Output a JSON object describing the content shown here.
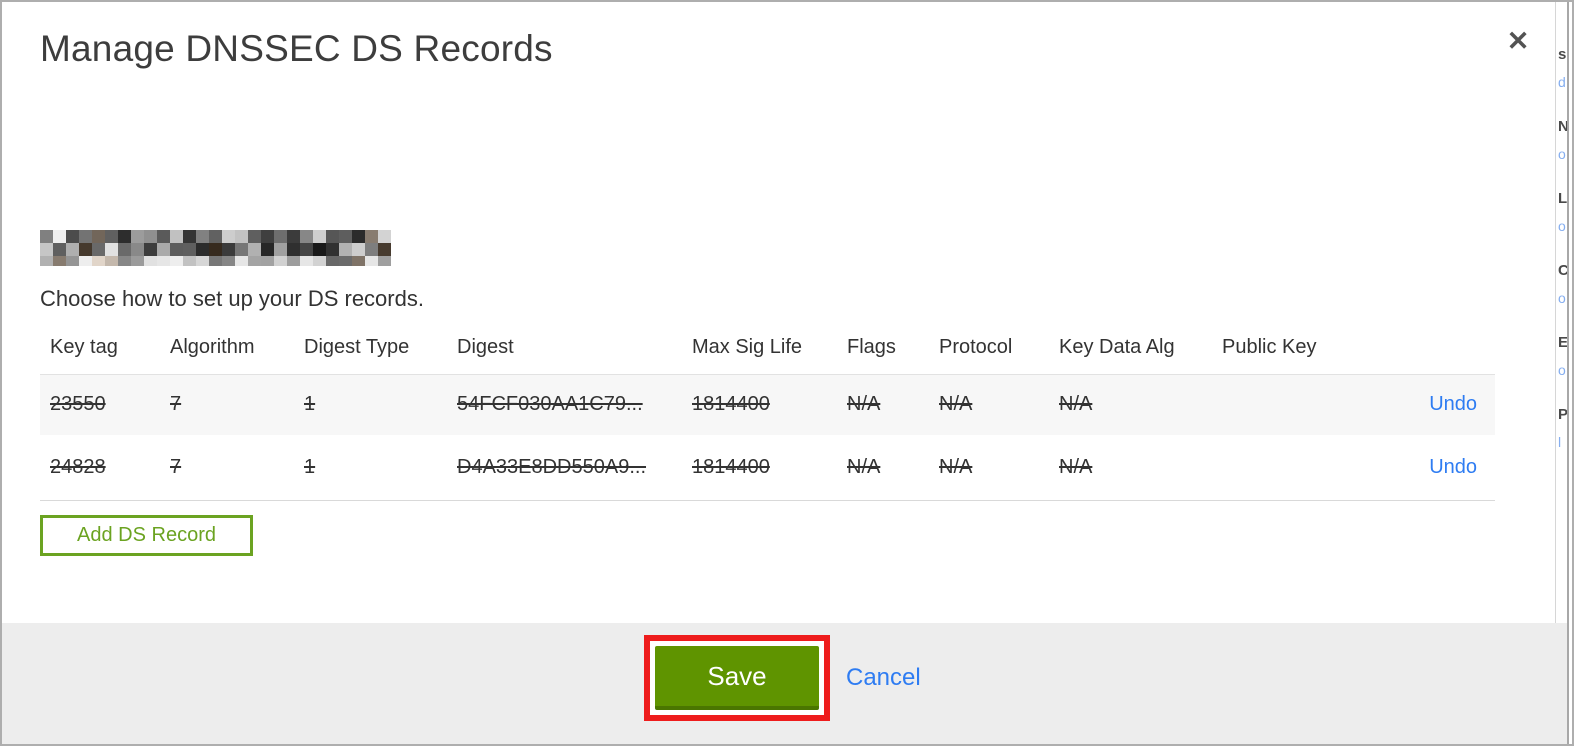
{
  "modal": {
    "title": "Manage DNSSEC DS Records",
    "close_icon": "✕",
    "subtitle": "Choose how to set up your DS records."
  },
  "table": {
    "columns": [
      "Key tag",
      "Algorithm",
      "Digest Type",
      "Digest",
      "Max Sig Life",
      "Flags",
      "Protocol",
      "Key Data Alg",
      "Public Key"
    ],
    "row_keys": [
      "key_tag",
      "algorithm",
      "digest_type",
      "digest",
      "max_sig_life",
      "flags",
      "protocol",
      "key_data_alg",
      "public_key"
    ],
    "rows": [
      {
        "key_tag": "23550",
        "algorithm": "7",
        "digest_type": "1",
        "digest": "54FCF030AA1C79...",
        "max_sig_life": "1814400",
        "flags": "N/A",
        "protocol": "N/A",
        "key_data_alg": "N/A",
        "public_key": "",
        "action": "Undo",
        "struck": true
      },
      {
        "key_tag": "24828",
        "algorithm": "7",
        "digest_type": "1",
        "digest": "D4A33E8DD550A9...",
        "max_sig_life": "1814400",
        "flags": "N/A",
        "protocol": "N/A",
        "key_data_alg": "N/A",
        "public_key": "",
        "action": "Undo",
        "struck": true
      }
    ],
    "add_button_label": "Add DS Record"
  },
  "footer": {
    "save_label": "Save",
    "cancel_label": "Cancel"
  },
  "right_strip": {
    "fragments": [
      {
        "char": "s",
        "style": "dark"
      },
      {
        "char": "d",
        "style": "blue"
      },
      {
        "char": "N",
        "style": "dark"
      },
      {
        "char": "o",
        "style": "blue"
      },
      {
        "char": "L",
        "style": "dark"
      },
      {
        "char": "o",
        "style": "blue"
      },
      {
        "char": "C",
        "style": "dark"
      },
      {
        "char": "o",
        "style": "blue"
      },
      {
        "char": "E",
        "style": "dark"
      },
      {
        "char": "o",
        "style": "blue"
      },
      {
        "char": "P",
        "style": "dark"
      },
      {
        "char": "l",
        "style": "blue"
      }
    ]
  },
  "colors": {
    "save_button_green": "#5f9400",
    "add_button_green": "#6ba321",
    "link_blue": "#2e7cf2",
    "annotation_red": "#ee1c1c",
    "footer_bg": "#ededed",
    "alt_row_bg": "#f7f7f7"
  }
}
